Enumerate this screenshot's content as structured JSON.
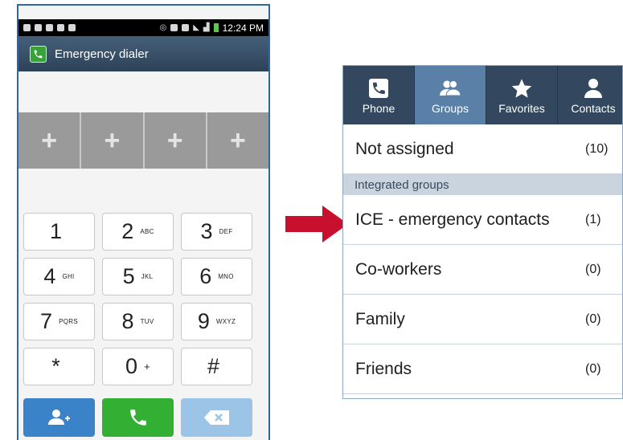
{
  "dialer": {
    "status_time": "12:24 PM",
    "title": "Emergency dialer",
    "slots": [
      "+",
      "+",
      "+",
      "+"
    ],
    "keys": [
      [
        {
          "digit": "1",
          "letters": ""
        },
        {
          "digit": "2",
          "letters": "ABC"
        },
        {
          "digit": "3",
          "letters": "DEF"
        }
      ],
      [
        {
          "digit": "4",
          "letters": "GHI"
        },
        {
          "digit": "5",
          "letters": "JKL"
        },
        {
          "digit": "6",
          "letters": "MNO"
        }
      ],
      [
        {
          "digit": "7",
          "letters": "PQRS"
        },
        {
          "digit": "8",
          "letters": "TUV"
        },
        {
          "digit": "9",
          "letters": "WXYZ"
        }
      ],
      [
        {
          "digit": "*",
          "letters": ""
        },
        {
          "digit": "0",
          "letters": "+"
        },
        {
          "digit": "#",
          "letters": ""
        }
      ]
    ],
    "actions": {
      "contacts_icon": "add-contact-icon",
      "call_icon": "phone-icon",
      "delete_icon": "backspace-icon"
    },
    "colors": {
      "call": "#33b034",
      "contacts": "#3a83c8",
      "delete": "#9cc4e6",
      "title_bar": "#34495e"
    }
  },
  "arrow": {
    "color": "#c8102e"
  },
  "contacts": {
    "tabs": [
      {
        "label": "Phone",
        "icon": "phone-icon",
        "active": false
      },
      {
        "label": "Groups",
        "icon": "groups-icon",
        "active": true
      },
      {
        "label": "Favorites",
        "icon": "star-icon",
        "active": false
      },
      {
        "label": "Contacts",
        "icon": "person-icon",
        "active": false
      }
    ],
    "not_assigned": {
      "label": "Not assigned",
      "count": "(10)"
    },
    "section_header": "Integrated groups",
    "groups": [
      {
        "label": "ICE - emergency contacts",
        "count": "(1)"
      },
      {
        "label": "Co-workers",
        "count": "(0)"
      },
      {
        "label": "Family",
        "count": "(0)"
      },
      {
        "label": "Friends",
        "count": "(0)"
      }
    ]
  }
}
